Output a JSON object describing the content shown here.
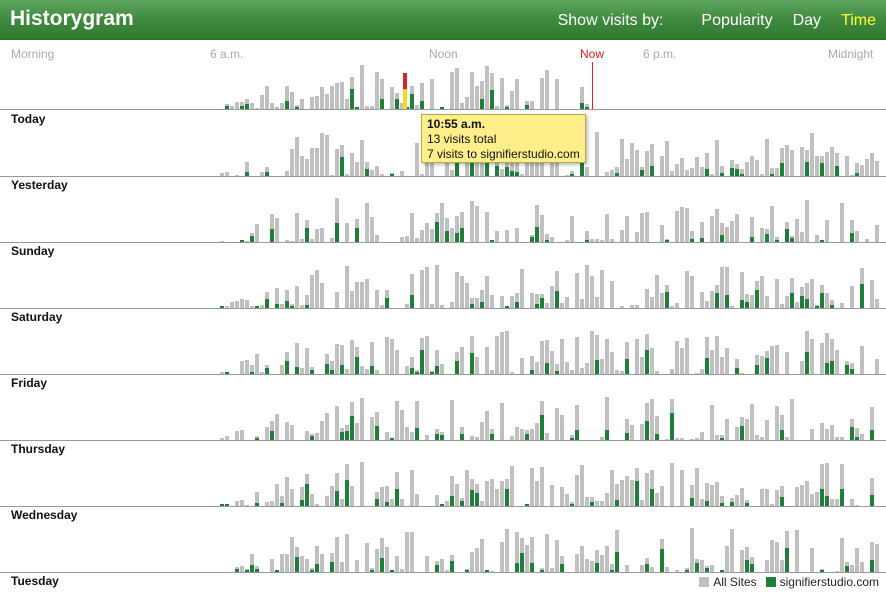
{
  "header": {
    "title": "Historygram",
    "show_by_label": "Show visits by:",
    "options": [
      {
        "label": "Popularity",
        "active": false
      },
      {
        "label": "Day",
        "active": false
      },
      {
        "label": "Time",
        "active": true
      }
    ]
  },
  "time_axis": {
    "morning": "Morning",
    "six_am": "6 a.m.",
    "noon": "Noon",
    "now": "Now",
    "six_pm": "6 p.m.",
    "midnight": "Midnight"
  },
  "days": [
    {
      "label": "Today"
    },
    {
      "label": "Yesterday"
    },
    {
      "label": "Sunday"
    },
    {
      "label": "Saturday"
    },
    {
      "label": "Friday"
    },
    {
      "label": "Thursday"
    },
    {
      "label": "Wednesday"
    },
    {
      "label": "Tuesday"
    }
  ],
  "tooltip": {
    "time": "10:55 a.m.",
    "total": "13 visits total",
    "site_visits": "7 visits to signifierstudio.com"
  },
  "legend": {
    "all_sites": "All Sites",
    "site": "signifierstudio.com"
  },
  "colors": {
    "all_sites": "#c0c0c0",
    "site": "#1e7e3a",
    "highlight": "#eedd22",
    "now": "#e82020",
    "header": "#3f8a3f",
    "active_option": "#ffff33"
  }
}
